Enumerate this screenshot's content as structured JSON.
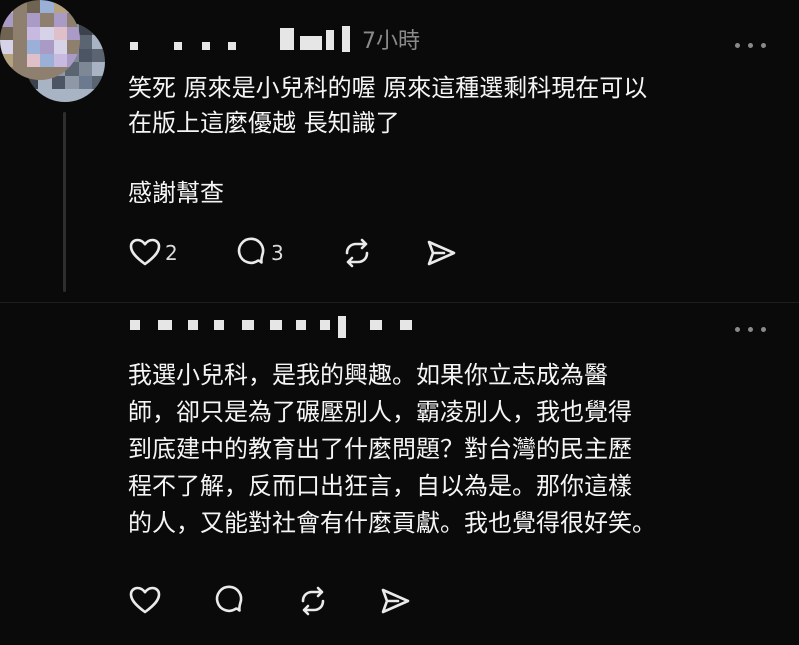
{
  "comments": [
    {
      "time": "7小時",
      "lines": [
        "笑死 原來是小兒科的喔 原來這種選剩科現在可以",
        "在版上這麼優越 長知識了"
      ],
      "extra_line": "感謝幫查",
      "likes": "2",
      "replies": "3",
      "icons": [
        "heart-icon",
        "comment-icon",
        "repost-icon",
        "share-icon",
        "more-icon"
      ]
    },
    {
      "lines": [
        "我選小兒科，是我的興趣。如果你立志成為醫",
        "師，卻只是為了碾壓別人，霸凌別人，我也覺得",
        "到底建中的教育出了什麼問題？對台灣的民主歷",
        "程不了解，反而口出狂言，自以為是。那你這樣",
        "的人，又能對社會有什麼貢獻。我也覺得很好笑。"
      ],
      "icons": [
        "heart-icon",
        "comment-icon",
        "repost-icon",
        "share-icon",
        "more-icon"
      ]
    }
  ],
  "colors": {
    "background": "#0a0a0a",
    "text": "#f5f5f5",
    "muted": "#8a8a8a",
    "thread_line": "#2e2e2e"
  }
}
